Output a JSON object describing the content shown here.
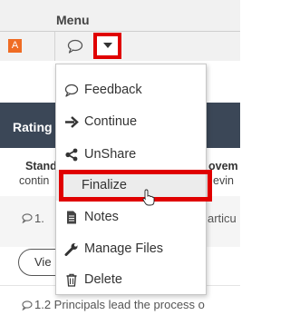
{
  "header": {
    "menu_title": "Menu",
    "app_badge": "A"
  },
  "background": {
    "rating": "Rating",
    "standard_partial": "Stand",
    "improvement_partial": "ovem",
    "contin_partial": "contin",
    "achiev_partial": "evin",
    "row1_number": "1.",
    "row1_tail": "articu",
    "view_partial": "Vie",
    "row2_text": "1.2 Principals lead the process o"
  },
  "menu": {
    "items": [
      {
        "label": "Feedback",
        "icon": "speech-bubble-icon"
      },
      {
        "label": "Continue",
        "icon": "arrow-right-icon"
      },
      {
        "label": "UnShare",
        "icon": "share-icon"
      },
      {
        "label": "Finalize",
        "icon": "none"
      },
      {
        "label": "Notes",
        "icon": "document-icon"
      },
      {
        "label": "Manage Files",
        "icon": "wrench-icon"
      },
      {
        "label": "Delete",
        "icon": "trash-icon"
      }
    ]
  },
  "colors": {
    "highlight_red": "#e00000",
    "badge_orange": "#ef6c24",
    "rating_bar": "#3b4757"
  }
}
